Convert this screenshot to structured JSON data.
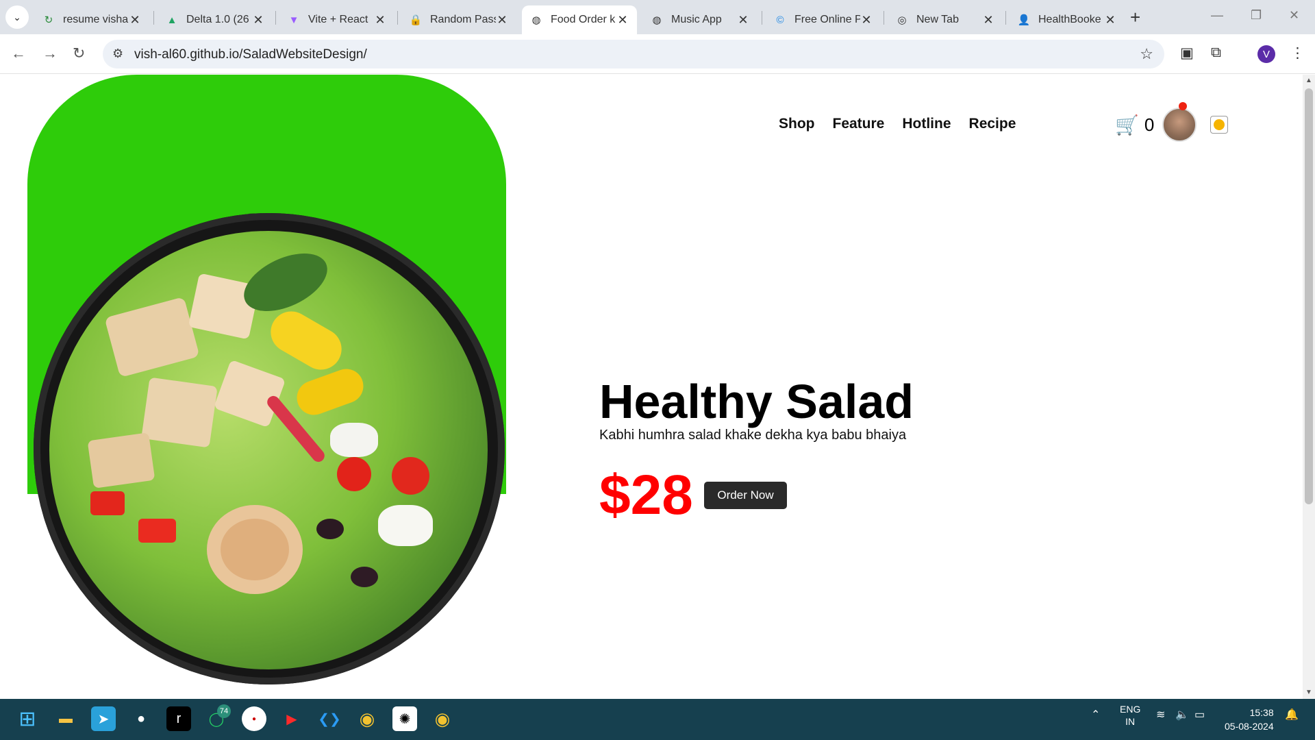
{
  "browser": {
    "tabs": [
      {
        "label": "resume visha",
        "icon": "refresh-leaf-icon"
      },
      {
        "label": "Delta 1.0 (26",
        "icon": "drive-icon"
      },
      {
        "label": "Vite + React",
        "icon": "vite-icon"
      },
      {
        "label": "Random Pass",
        "icon": "lock-icon"
      },
      {
        "label": "Food Order k",
        "icon": "globe-icon"
      },
      {
        "label": "Music App",
        "icon": "globe-icon"
      },
      {
        "label": "Free Online P",
        "icon": "canva-icon"
      },
      {
        "label": "New Tab",
        "icon": "chrome-icon"
      },
      {
        "label": "HealthBooke",
        "icon": "person-icon"
      }
    ],
    "url": "vish-al60.github.io/SaladWebsiteDesign/",
    "profile_initial": "V"
  },
  "site": {
    "nav": [
      "Shop",
      "Feature",
      "Hotline",
      "Recipe"
    ],
    "cart_count": "0",
    "hero": {
      "title": "Healthy Salad",
      "subtitle": "Kabhi humhra salad khake dekha kya babu bhaiya",
      "price": "$28",
      "order_button": "Order Now"
    },
    "colors": {
      "accent_green": "#2ecc0a",
      "price_red": "#ff0000"
    }
  },
  "taskbar": {
    "whatsapp_badge": "74",
    "language": "ENG",
    "region": "IN",
    "time": "15:38",
    "date": "05-08-2024"
  }
}
